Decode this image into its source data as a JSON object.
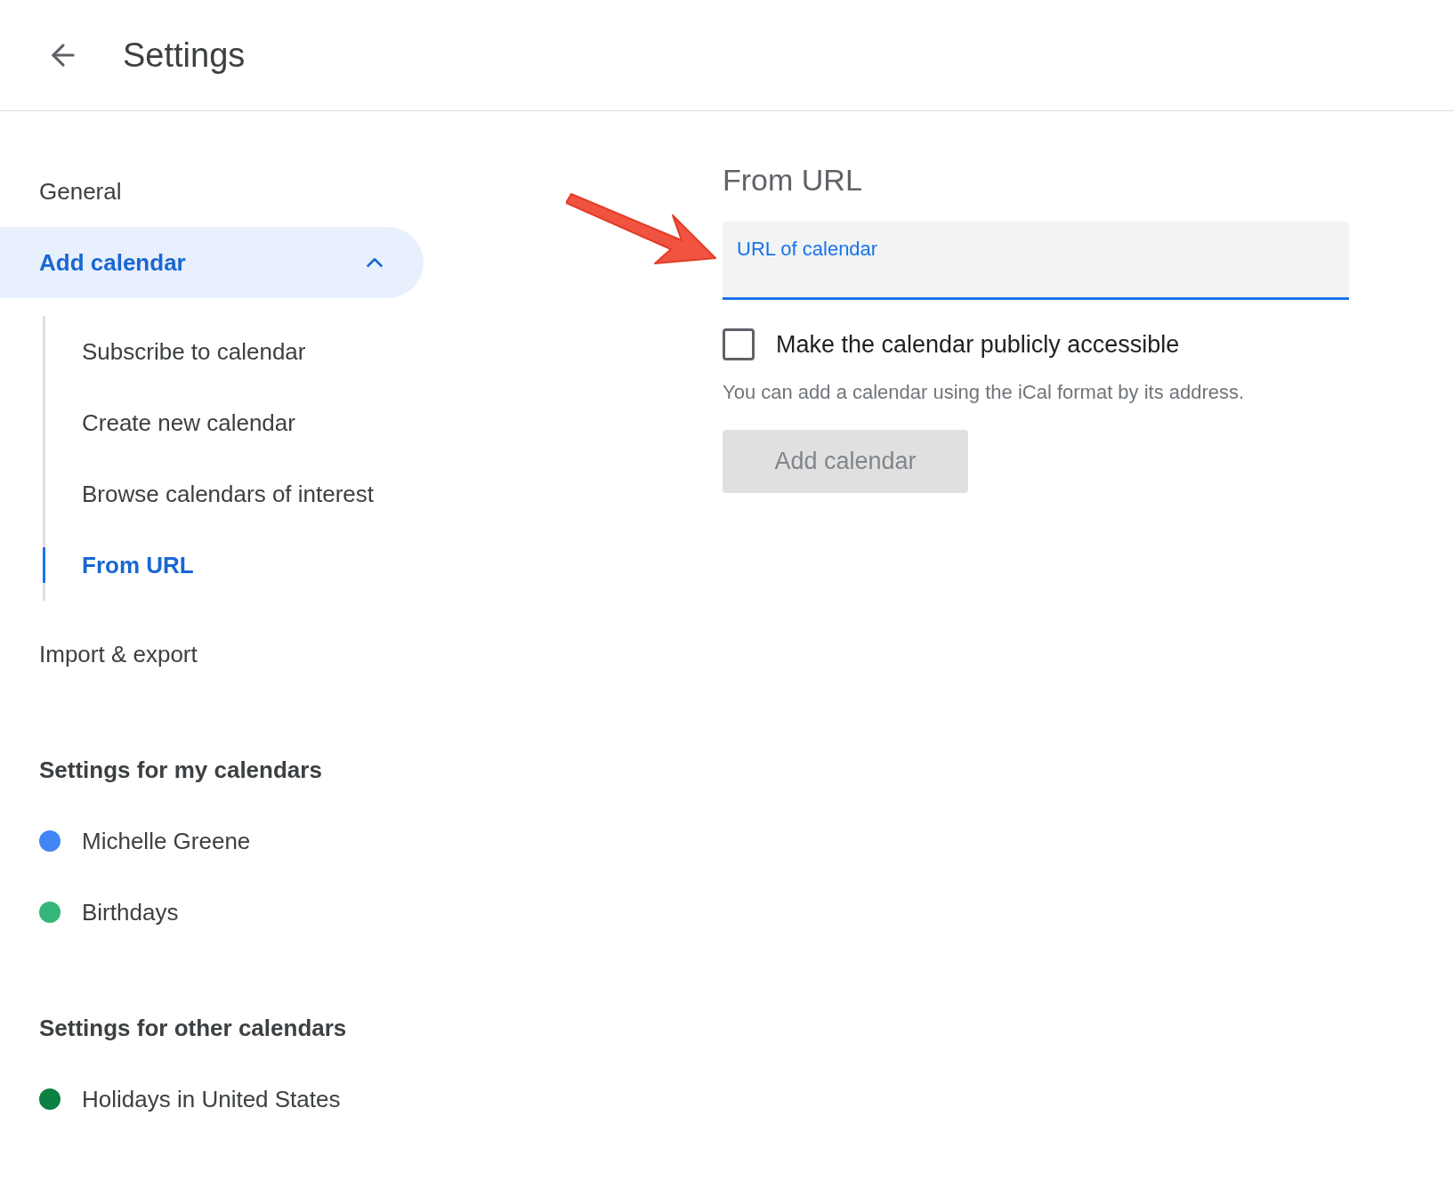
{
  "header": {
    "title": "Settings"
  },
  "sidebar": {
    "nav": [
      {
        "label": "General",
        "selected": false
      },
      {
        "label": "Add calendar",
        "selected": true,
        "expanded": true,
        "children": [
          {
            "label": "Subscribe to calendar",
            "selected": false
          },
          {
            "label": "Create new calendar",
            "selected": false
          },
          {
            "label": "Browse calendars of interest",
            "selected": false
          },
          {
            "label": "From URL",
            "selected": true
          }
        ]
      },
      {
        "label": "Import & export",
        "selected": false
      }
    ],
    "sections": [
      {
        "title": "Settings for my calendars",
        "calendars": [
          {
            "name": "Michelle Greene",
            "color": "#4285f4"
          },
          {
            "name": "Birthdays",
            "color": "#33b679"
          }
        ]
      },
      {
        "title": "Settings for other calendars",
        "calendars": [
          {
            "name": "Holidays in United States",
            "color": "#0b8043"
          }
        ]
      }
    ]
  },
  "main": {
    "title": "From URL",
    "url_field": {
      "label": "URL of calendar"
    },
    "public_checkbox": {
      "label": "Make the calendar publicly accessible",
      "checked": false
    },
    "help_text": "You can add a calendar using the iCal format by its address.",
    "add_button": {
      "label": "Add calendar",
      "disabled": true
    }
  }
}
